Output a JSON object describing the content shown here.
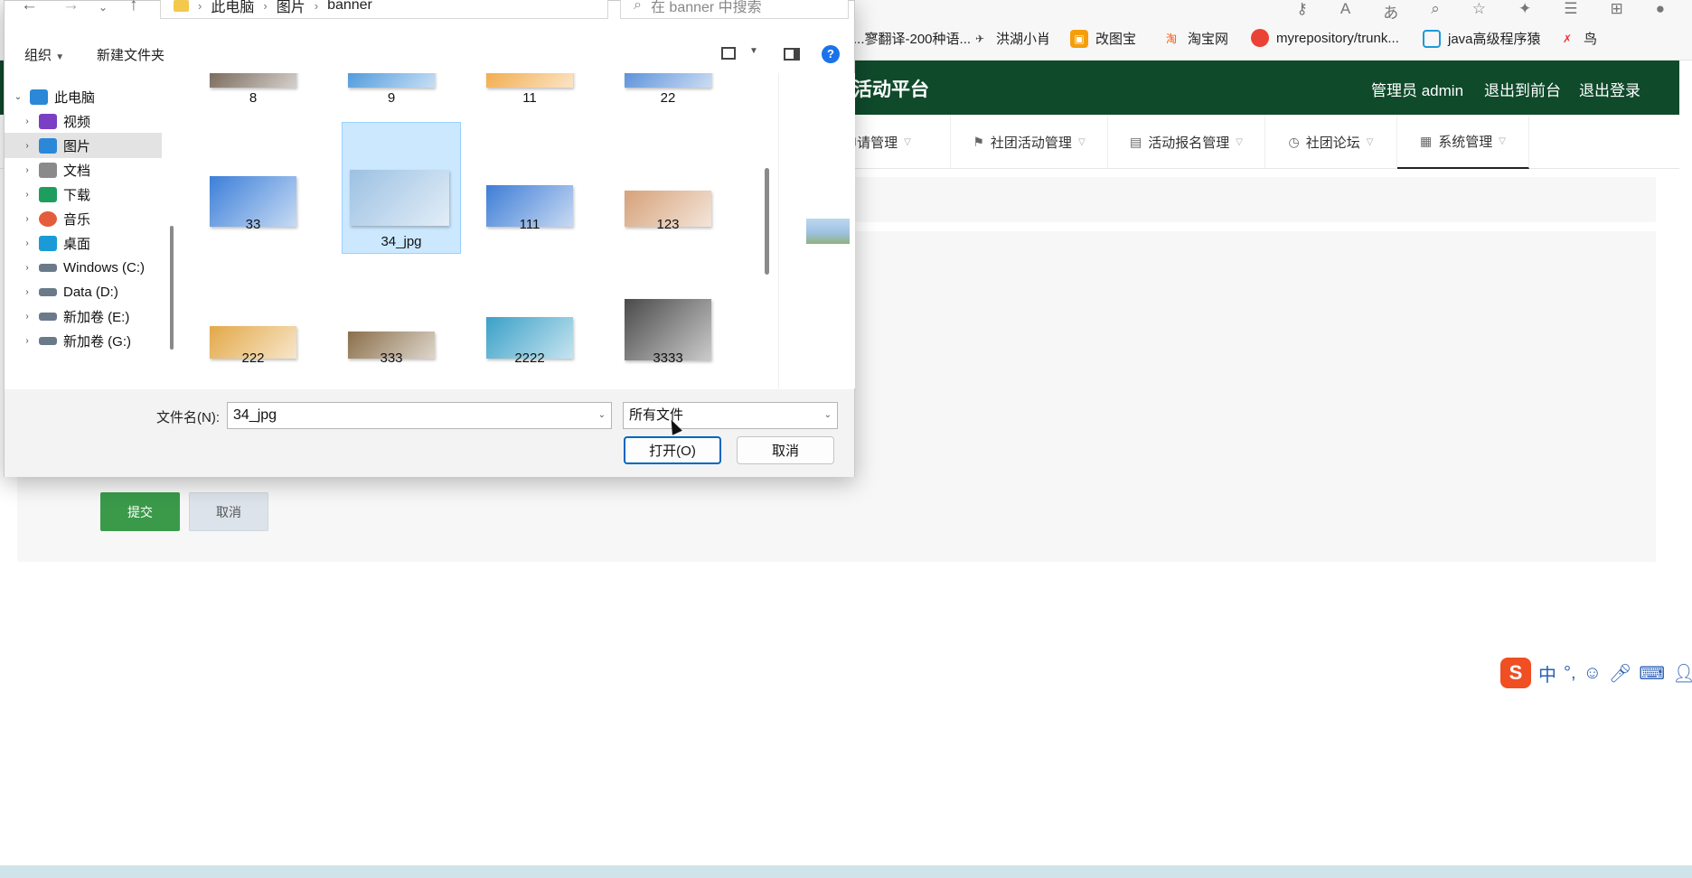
{
  "browser": {
    "bookmarks": [
      {
        "label": "...寥翻译-200种语...",
        "icon": "translate-icon"
      },
      {
        "label": "洪湖小肖",
        "icon": "bird-icon"
      },
      {
        "label": "改图宝",
        "icon": "image-edit-icon"
      },
      {
        "label": "淘宝网",
        "icon": "taobao-icon"
      },
      {
        "label": "myrepository/trunk...",
        "icon": "repository-icon"
      },
      {
        "label": "java高级程序猿",
        "icon": "bilibili-icon"
      },
      {
        "label": "鸟",
        "icon": "bird2-icon"
      }
    ]
  },
  "app": {
    "title": "活动平台",
    "admin_label": "管理员 admin",
    "goto_front": "退出到前台",
    "logout": "退出登录",
    "nav": [
      {
        "label": "社团申请管理",
        "icon": "group-icon"
      },
      {
        "label": "社团活动管理",
        "icon": "flag-icon"
      },
      {
        "label": "活动报名管理",
        "icon": "briefcase-icon"
      },
      {
        "label": "社团论坛",
        "icon": "clock-icon"
      },
      {
        "label": "系统管理",
        "icon": "settings-icon"
      }
    ],
    "submit_label": "提交",
    "cancel_label": "取消"
  },
  "ime": {
    "logo": "S",
    "lang": "中",
    "punct": "°,"
  },
  "dialog": {
    "breadcrumb": [
      "此电脑",
      "图片",
      "banner"
    ],
    "search_placeholder": "在 banner 中搜索",
    "organize": "组织",
    "new_folder": "新建文件夹",
    "help": "?",
    "nav_items": [
      {
        "label": "此电脑",
        "expanded": true,
        "color": "#2b88d8"
      },
      {
        "label": "视频",
        "color": "#7b3fc4"
      },
      {
        "label": "图片",
        "color": "#2b88d8",
        "selected": true
      },
      {
        "label": "文档",
        "color": "#8a8a8a"
      },
      {
        "label": "下载",
        "color": "#1e9e5e"
      },
      {
        "label": "音乐",
        "color": "#e35d3c"
      },
      {
        "label": "桌面",
        "color": "#1a9bd7"
      },
      {
        "label": "Windows (C:)",
        "color": "#6a7a8a"
      },
      {
        "label": "Data (D:)",
        "color": "#6a7a8a"
      },
      {
        "label": "新加卷 (E:)",
        "color": "#6a7a8a"
      },
      {
        "label": "新加卷 (G:)",
        "color": "#6a7a8a"
      }
    ],
    "files": [
      {
        "name": "8",
        "thumb": "#6b5a4a"
      },
      {
        "name": "9",
        "thumb": "#3d8fd8"
      },
      {
        "name": "11",
        "thumb": "#f0a33a"
      },
      {
        "name": "22",
        "thumb": "#4a86d6"
      },
      {
        "name": "33",
        "thumb": "#3c7fd9"
      },
      {
        "name": "34_jpg",
        "thumb": "#9cc1e3",
        "selected": true
      },
      {
        "name": "111",
        "thumb": "#3e7dd6"
      },
      {
        "name": "123",
        "thumb": "#d6a27a"
      },
      {
        "name": "222",
        "thumb": "#e3a848"
      },
      {
        "name": "333",
        "thumb": "#8a6f4a"
      },
      {
        "name": "2222",
        "thumb": "#3aa0c8"
      },
      {
        "name": "3333",
        "thumb": "#4a4a4a"
      }
    ],
    "filename_label": "文件名(N):",
    "filename_value": "34_jpg",
    "filetype_value": "所有文件",
    "open_label": "打开(O)",
    "cancel_label": "取消"
  },
  "colors": {
    "header": "#0f4a2b",
    "accent_blue": "#0067c0",
    "selection": "#cce8ff"
  }
}
